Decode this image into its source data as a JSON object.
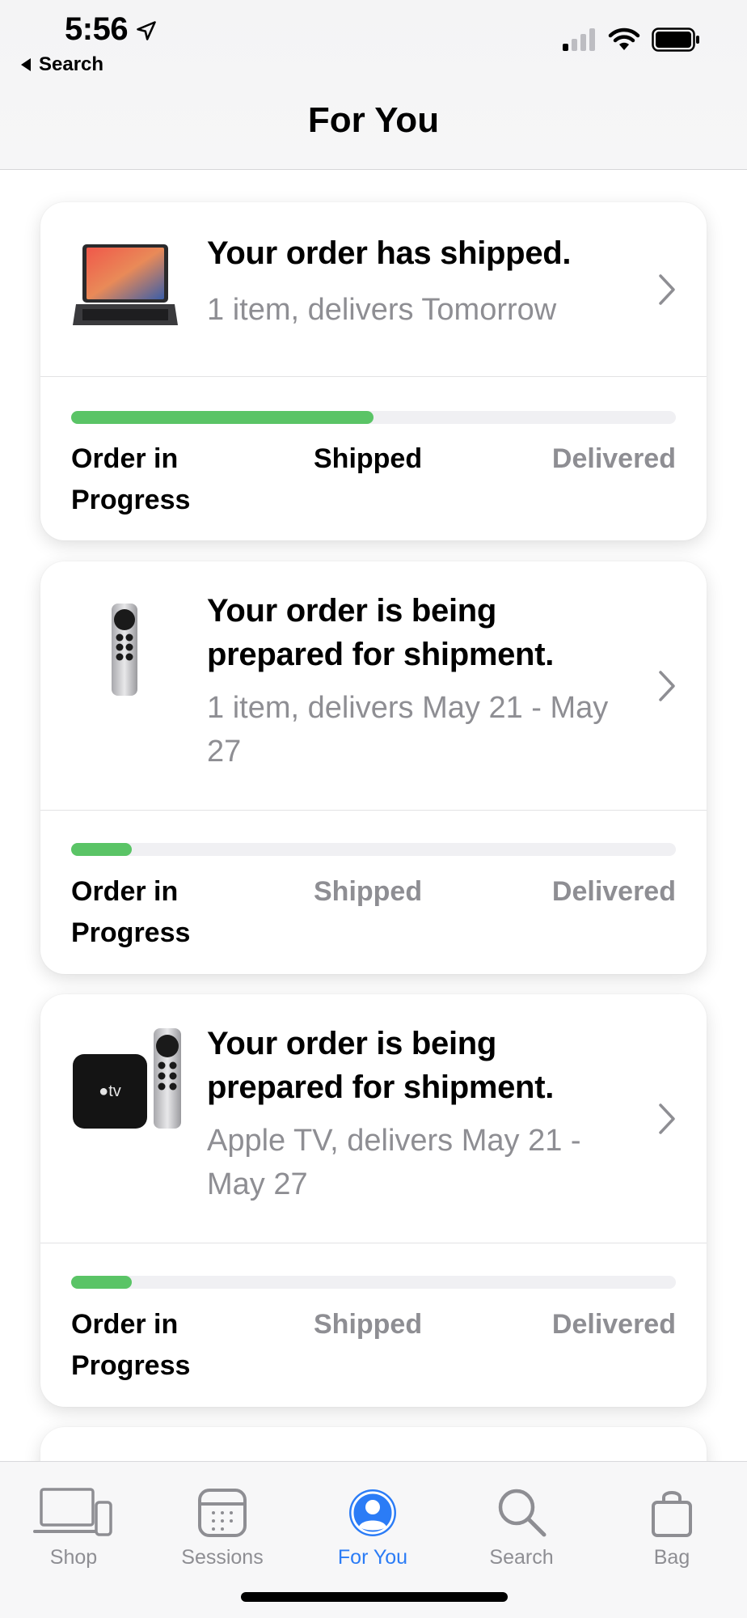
{
  "status_bar": {
    "time": "5:56",
    "back_label": "Search"
  },
  "nav": {
    "title": "For You"
  },
  "orders": [
    {
      "title": "Your order has shipped.",
      "subtitle": "1 item, delivers Tomorrow",
      "progress": 0.5,
      "steps": [
        "Order in Progress",
        "Shipped",
        "Delivered"
      ],
      "active_step": 2
    },
    {
      "title": "Your order is being prepared for shipment.",
      "subtitle": "1 item, delivers May 21 - May 27",
      "progress": 0.1,
      "steps": [
        "Order in Progress",
        "Shipped",
        "Delivered"
      ],
      "active_step": 1
    },
    {
      "title": "Your order is being prepared for shipment.",
      "subtitle": "Apple TV, delivers May 21 - May 27",
      "progress": 0.1,
      "steps": [
        "Order in Progress",
        "Shipped",
        "Delivered"
      ],
      "active_step": 1
    }
  ],
  "tabs": [
    {
      "label": "Shop",
      "icon": "devices-icon"
    },
    {
      "label": "Sessions",
      "icon": "calendar-icon"
    },
    {
      "label": "For You",
      "icon": "person-icon",
      "active": true
    },
    {
      "label": "Search",
      "icon": "search-icon"
    },
    {
      "label": "Bag",
      "icon": "bag-icon"
    }
  ],
  "colors": {
    "accent": "#2b7cf6",
    "progress_fill": "#5ac466",
    "secondary_text": "#8e8e93"
  }
}
